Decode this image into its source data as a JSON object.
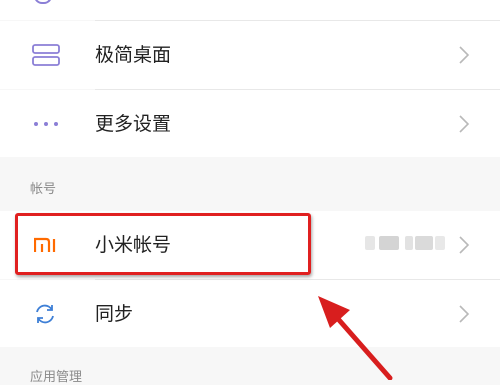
{
  "settings": {
    "items_top": [
      {
        "label": "",
        "icon": "partial-icon"
      },
      {
        "label": "极简桌面",
        "icon": "simple-desktop-icon"
      },
      {
        "label": "更多设置",
        "icon": "more-dots-icon"
      }
    ],
    "account_section": {
      "header": "帐号",
      "items": [
        {
          "label": "小米帐号",
          "icon": "mi-logo-icon",
          "value": "blurred"
        },
        {
          "label": "同步",
          "icon": "sync-icon"
        }
      ]
    },
    "next_section_header": "应用管理"
  },
  "colors": {
    "accent_purple": "#8b7fd6",
    "mi_orange": "#ff6a00",
    "sync_blue": "#3e7fd6",
    "highlight_red": "#e02020"
  }
}
